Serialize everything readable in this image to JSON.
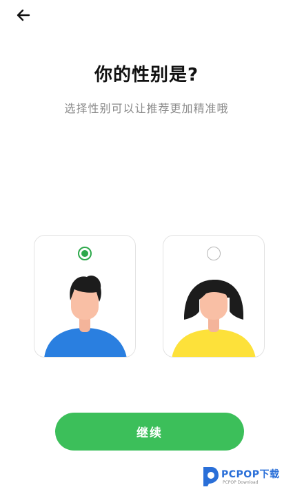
{
  "header": {
    "back_icon": "arrow-left-icon"
  },
  "main": {
    "title": "你的性别是?",
    "subtitle": "选择性别可以让推荐更加精准哦"
  },
  "options": [
    {
      "gender": "male",
      "selected": true,
      "avatar_icon": "male-avatar-icon",
      "shirt_color": "#2a7fe0"
    },
    {
      "gender": "female",
      "selected": false,
      "avatar_icon": "female-avatar-icon",
      "shirt_color": "#fde13a"
    }
  ],
  "footer": {
    "continue_label": "继续",
    "button_color": "#3cbf5a"
  },
  "watermark": {
    "brand": "PCPOP下载",
    "sub": "PCPOP Download"
  }
}
